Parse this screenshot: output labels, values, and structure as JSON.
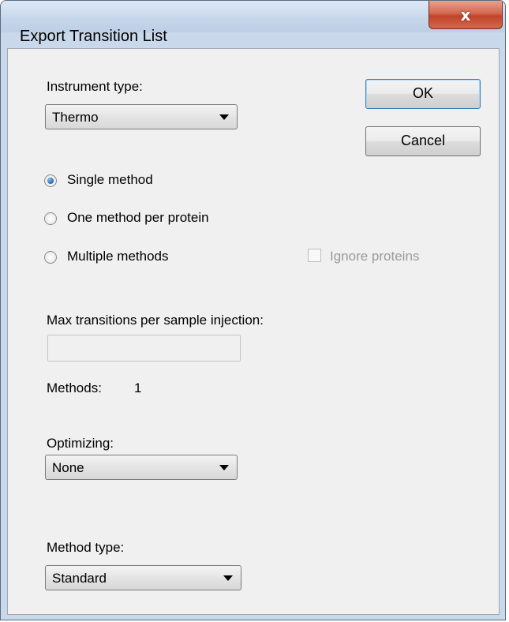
{
  "window": {
    "title": "Export Transition List",
    "close_glyph": "x"
  },
  "instrument_type": {
    "label": "Instrument type:",
    "value": "Thermo"
  },
  "buttons": {
    "ok": "OK",
    "cancel": "Cancel"
  },
  "export_strategy": {
    "options": [
      {
        "label": "Single method",
        "selected": true
      },
      {
        "label": "One method per protein",
        "selected": false
      },
      {
        "label": "Multiple methods",
        "selected": false
      }
    ]
  },
  "ignore_proteins": {
    "label": "Ignore proteins",
    "checked": false,
    "enabled": false
  },
  "max_transitions": {
    "label": "Max transitions per sample injection:",
    "value": ""
  },
  "methods": {
    "label": "Methods:",
    "count": "1"
  },
  "optimizing": {
    "label": "Optimizing:",
    "value": "None"
  },
  "method_type": {
    "label": "Method type:",
    "value": "Standard"
  },
  "colors": {
    "accent": "#3c7fb1",
    "close_button": "#c0442a",
    "dialog_bg": "#f0f0f0"
  }
}
